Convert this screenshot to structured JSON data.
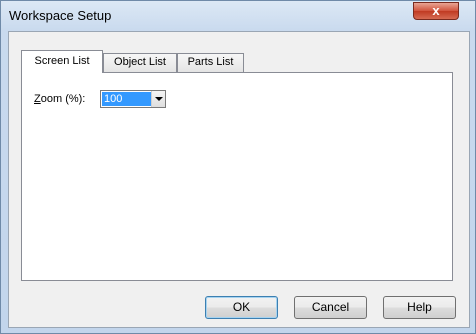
{
  "window": {
    "title": "Workspace Setup",
    "close_glyph": "x"
  },
  "tabs": [
    {
      "label": "Screen List",
      "active": true
    },
    {
      "label": "Object List",
      "active": false
    },
    {
      "label": "Parts List",
      "active": false
    }
  ],
  "zoom": {
    "label_mnemonic": "Z",
    "label_rest": "oom (%):",
    "value": "100"
  },
  "buttons": {
    "ok": "OK",
    "cancel": "Cancel",
    "help": "Help"
  },
  "colors": {
    "selection": "#3399ff",
    "close_button": "#c9452d",
    "title_bar": "#c9daee"
  }
}
